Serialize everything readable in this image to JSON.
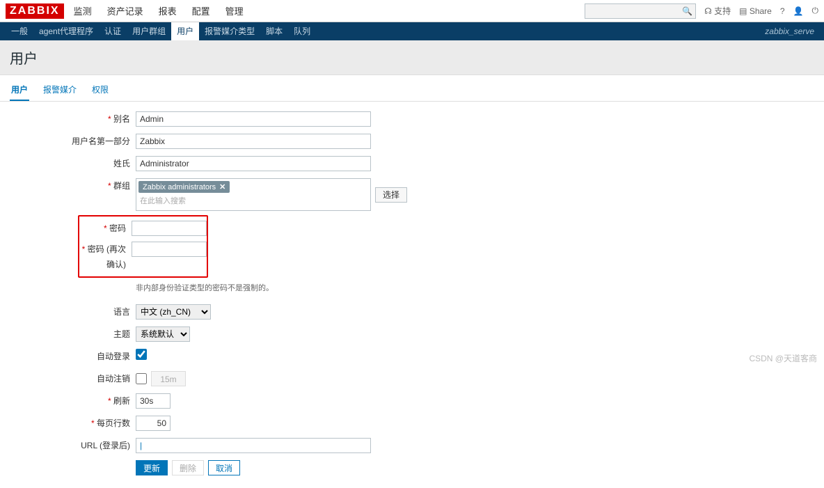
{
  "brand": "ZABBIX",
  "mainnav": {
    "items": [
      "监测",
      "资产记录",
      "报表",
      "配置",
      "管理"
    ],
    "activeIndex": 4
  },
  "topright": {
    "support": "支持",
    "share": "Share"
  },
  "subnav": {
    "items": [
      "一般",
      "agent代理程序",
      "认证",
      "用户群组",
      "用户",
      "报警媒介类型",
      "脚本",
      "队列"
    ],
    "activeIndex": 4,
    "host": "zabbix_serve"
  },
  "pageTitle": "用户",
  "tabs": {
    "items": [
      "用户",
      "报警媒介",
      "权限"
    ],
    "activeIndex": 0
  },
  "form": {
    "alias": {
      "label": "别名",
      "value": "Admin"
    },
    "firstname": {
      "label": "用户名第一部分",
      "value": "Zabbix"
    },
    "lastname": {
      "label": "姓氏",
      "value": "Administrator"
    },
    "groups": {
      "label": "群组",
      "tag": "Zabbix administrators",
      "placeholder": "在此输入搜索",
      "selectBtn": "选择"
    },
    "password": {
      "label": "密码",
      "value": ""
    },
    "passwordConfirm": {
      "label": "密码 (再次确认)",
      "value": ""
    },
    "passwordNote": "非内部身份验证类型的密码不是强制的。",
    "language": {
      "label": "语言",
      "value": "中文 (zh_CN)"
    },
    "theme": {
      "label": "主题",
      "value": "系统默认"
    },
    "autologin": {
      "label": "自动登录",
      "checked": true
    },
    "autologout": {
      "label": "自动注销",
      "checked": false,
      "value": "15m"
    },
    "refresh": {
      "label": "刷新",
      "value": "30s"
    },
    "perpage": {
      "label": "每页行数",
      "value": "50"
    },
    "url": {
      "label": "URL (登录后)",
      "value": ""
    },
    "buttons": {
      "update": "更新",
      "delete": "删除",
      "cancel": "取消"
    }
  },
  "watermark": "CSDN @天道客商"
}
